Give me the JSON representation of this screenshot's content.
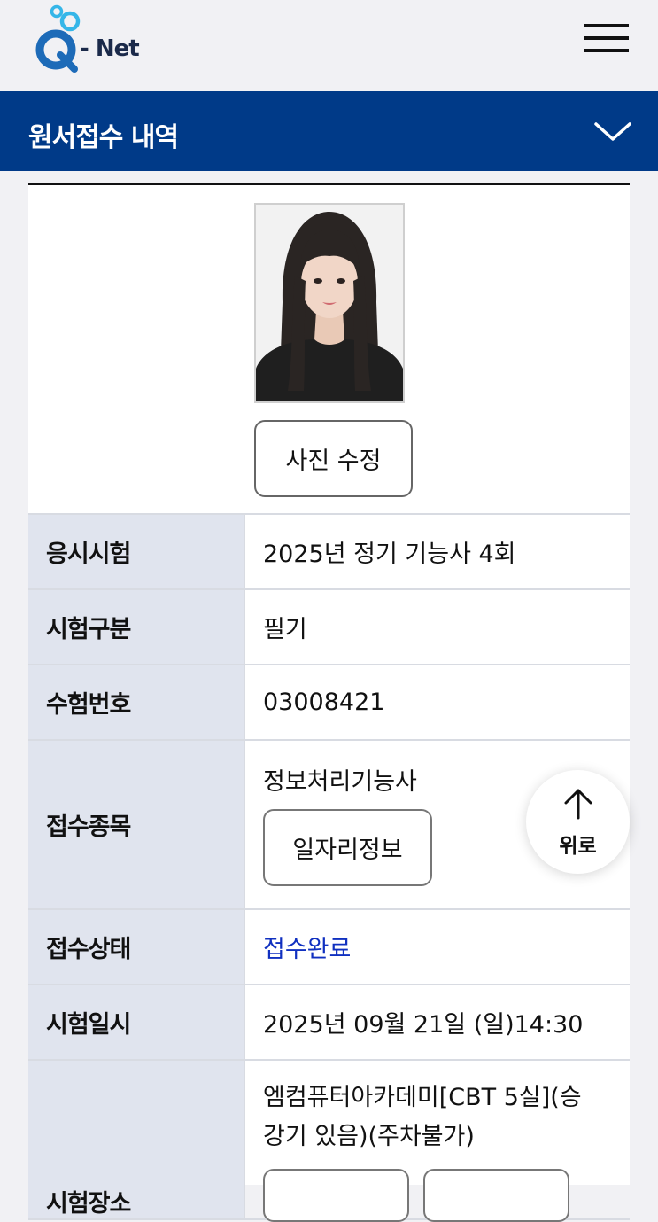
{
  "header": {
    "logo_text": "- Net",
    "logo_letter": "Q"
  },
  "section": {
    "title": "원서접수 내역"
  },
  "photo": {
    "edit_button_label": "사진 수정"
  },
  "details": {
    "exam": {
      "label": "응시시험",
      "value": "2025년 정기 기능사 4회"
    },
    "exam_type": {
      "label": "시험구분",
      "value": "필기"
    },
    "exam_number": {
      "label": "수험번호",
      "value": "03008421"
    },
    "subject": {
      "label": "접수종목",
      "value": "정보처리기능사",
      "button_label": "일자리정보"
    },
    "status": {
      "label": "접수상태",
      "value": "접수완료"
    },
    "datetime": {
      "label": "시험일시",
      "value": "2025년 09월 21일 (일)14:30"
    },
    "venue": {
      "label": "시험장소",
      "value_line1": "엠컴퓨터아카데미[CBT 5실](승",
      "value_line2": "강기 있음)(주차불가)"
    }
  },
  "scroll_top": {
    "label": "위로"
  },
  "colors": {
    "brand_navy": "#003a88",
    "status_blue": "#1030c0",
    "label_bg": "#e0e4ee",
    "logo_cyan": "#35b6e8"
  },
  "icons": {
    "menu": "hamburger-icon",
    "expand": "chevron-down-icon",
    "top": "arrow-up-icon"
  }
}
